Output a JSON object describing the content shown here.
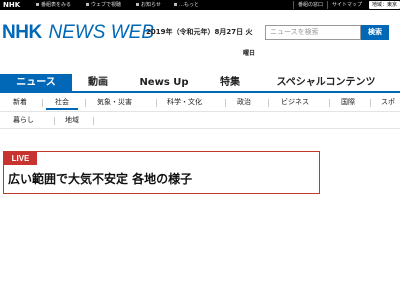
{
  "topbar": {
    "logo": "NHK",
    "links": [
      "番組表をみる",
      "ウェブで視聴",
      "お知らせ",
      "…もっと"
    ],
    "right": [
      "番組の窓口",
      "サイトマップ"
    ],
    "region_label": "地域：東京"
  },
  "header": {
    "logo_nhk": "NHK",
    "logo_news": "NEWS WEB",
    "date": "2019年（令和元年）8月27日 火",
    "weekday": "曜日",
    "search_placeholder": "ニュースを検索",
    "search_button": "検索"
  },
  "mainnav": {
    "items": [
      "ニュース",
      "動画",
      "News Up",
      "特集",
      "スペシャルコンテンツ"
    ]
  },
  "subnav": {
    "row1": [
      "新着",
      "社会",
      "気象・災害",
      "科学・文化",
      "政治",
      "ビジネス",
      "国際",
      "スポ"
    ],
    "row2": [
      "暮らし",
      "地域"
    ]
  },
  "live": {
    "badge": "LIVE",
    "title": "広い範囲で大気不安定 各地の様子"
  },
  "colors": {
    "brand_blue": "#0068b7",
    "live_red": "#c8332f"
  }
}
